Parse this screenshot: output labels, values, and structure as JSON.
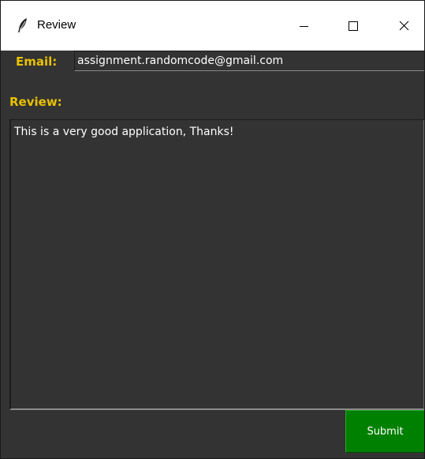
{
  "window": {
    "title": "Review",
    "icon": "feather-icon",
    "controls": {
      "minimize": "minimize-icon",
      "maximize": "maximize-icon",
      "close": "close-icon"
    }
  },
  "form": {
    "email_label": "Email:",
    "email_value": "assignment.randomcode@gmail.com",
    "review_label": "Review:",
    "review_text": "This is a very good application, Thanks!",
    "submit_label": "Submit"
  },
  "colors": {
    "background": "#333333",
    "label": "#e8c000",
    "text": "#ffffff",
    "submit_bg": "#008000"
  }
}
